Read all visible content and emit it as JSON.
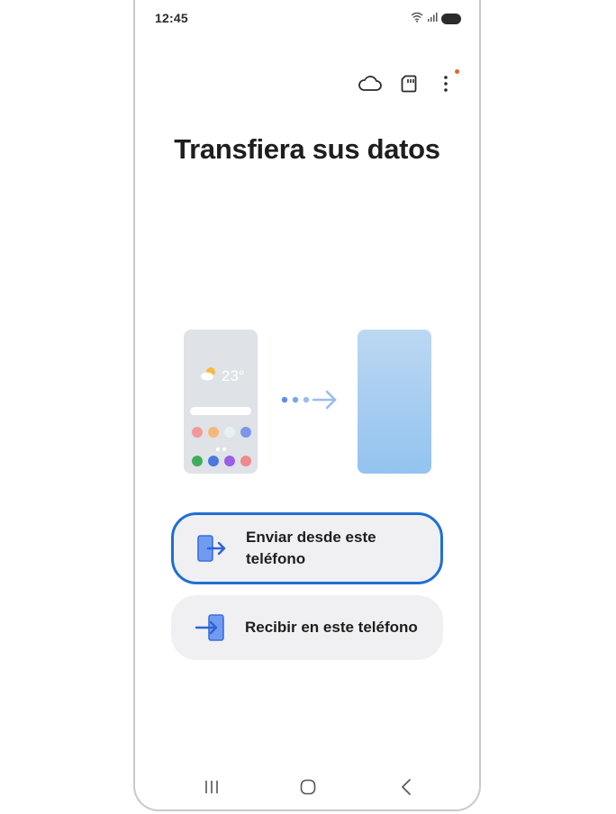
{
  "status_bar": {
    "time": "12:45"
  },
  "action_bar": {
    "icons": [
      "cloud-icon",
      "sd-card-icon",
      "more-options-icon"
    ]
  },
  "title": "Transfiera sus datos",
  "illustration": {
    "temperature": "23°"
  },
  "options": {
    "send": {
      "label_line1": "Enviar desde este",
      "label_line2": "teléfono",
      "selected": true
    },
    "receive": {
      "label": "Recibir en este teléfono",
      "selected": false
    }
  },
  "colors": {
    "accent": "#1f6fd1",
    "notification": "#e8632b",
    "card_bg": "#f0f0f2"
  }
}
